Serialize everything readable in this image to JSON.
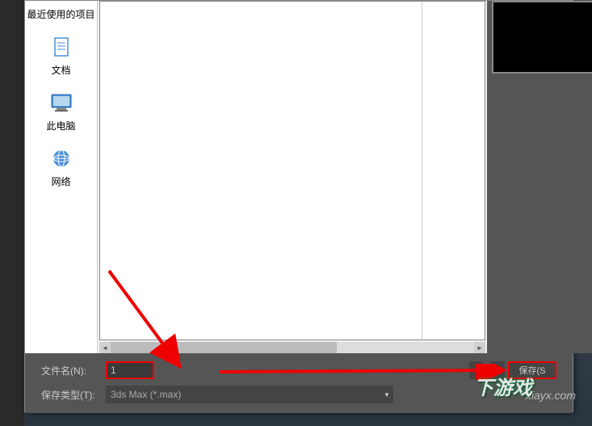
{
  "sidebar": {
    "items": [
      {
        "label": "最近使用的项目",
        "icon": "recent-icon"
      },
      {
        "label": "文档",
        "icon": "document-icon"
      },
      {
        "label": "此电脑",
        "icon": "computer-icon"
      },
      {
        "label": "网络",
        "icon": "network-icon"
      }
    ]
  },
  "form": {
    "filename_label": "文件名(N):",
    "filename_value": "1",
    "filetype_label": "保存类型(T):",
    "filetype_value": "3ds Max (*.max)"
  },
  "buttons": {
    "save_label": "保存(S",
    "plus_label": "+"
  },
  "watermark": {
    "url": "xiayx.com",
    "logo_text": "下游戏"
  },
  "annotations": {
    "highlight_color": "#e00000"
  }
}
